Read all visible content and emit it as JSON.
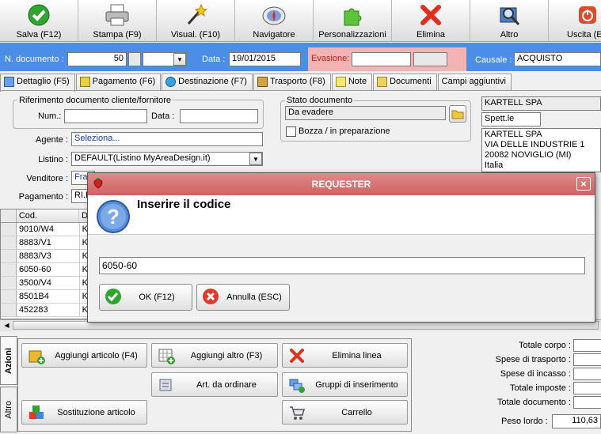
{
  "toolbar": {
    "buttons": [
      {
        "label": "Salva (F12)"
      },
      {
        "label": "Stampa (F9)"
      },
      {
        "label": "Visual. (F10)"
      },
      {
        "label": "Navigatore"
      },
      {
        "label": "Personalizzazioni"
      },
      {
        "label": "Elimina"
      },
      {
        "label": "Altro"
      },
      {
        "label": "Uscita (ES"
      }
    ]
  },
  "docbar": {
    "num_label": "N. documento :",
    "num_value": "50",
    "date_label": "Data :",
    "date_value": "19/01/2015",
    "evasione_label": "Evasione:",
    "causale_label": "Causale :",
    "causale_value": "ACQUISTO"
  },
  "tabs": [
    {
      "label": "Dettaglio (F5)"
    },
    {
      "label": "Pagamento (F6)"
    },
    {
      "label": "Destinazione (F7)"
    },
    {
      "label": "Trasporto (F8)"
    },
    {
      "label": "Note"
    },
    {
      "label": "Documenti"
    },
    {
      "label": "Campi aggiuntivi"
    }
  ],
  "form": {
    "rif_title": "Riferimento documento cliente/fornitore",
    "num_label": "Num.:",
    "data_label": "Data :",
    "agente_label": "Agente :",
    "agente_value": "Seleziona...",
    "listino_label": "Listino :",
    "listino_value": "DEFAULT(Listino MyAreaDesign.it)",
    "venditore_label": "Venditore :",
    "venditore_value": "Fran",
    "pagamento_label": "Pagamento :",
    "pagamento_value": "RI.B",
    "stato_title": "Stato documento",
    "stato_value": "Da evadere",
    "bozza_label": "Bozza / in preparazione"
  },
  "customer": {
    "name": "KARTELL SPA",
    "salutation": "Spett.le",
    "address": [
      "KARTELL SPA",
      "VIA DELLE INDUSTRIE 1",
      "20082 NOVIGLIO (MI)",
      "Italia"
    ]
  },
  "grid": {
    "headers": [
      "Cod.",
      "D"
    ],
    "rows": [
      {
        "cod": "9010/W4",
        "d": "K"
      },
      {
        "cod": "8883/V1",
        "d": "K"
      },
      {
        "cod": "8883/V3",
        "d": "K"
      },
      {
        "cod": "6050-60",
        "d": "K"
      },
      {
        "cod": "3500/V4",
        "d": "K"
      },
      {
        "cod": "8501B4",
        "d": "K"
      },
      {
        "cod": "452283",
        "d": "K"
      }
    ]
  },
  "dialog": {
    "title": "REQUESTER",
    "prompt": "Inserire il codice",
    "input_value": "6050-60",
    "ok_label": "OK (F12)",
    "cancel_label": "Annulla (ESC)",
    "close_glyph": "×"
  },
  "side_tabs": {
    "azioni": "Azioni",
    "altro": "Altro"
  },
  "actions": {
    "aggiungi_articolo": "Aggiungi articolo (F4)",
    "aggiungi_altro": "Aggiungi altro (F3)",
    "elimina_linea": "Elimina linea",
    "art_da_ordinare": "Art. da ordinare",
    "gruppi_inserimento": "Gruppi di inserimento",
    "sostituzione_articolo": "Sostituzione articolo",
    "carrello": "Carrello"
  },
  "totals": {
    "totale_corpo": "Totale corpo :",
    "spese_trasporto": "Spese di trasporto :",
    "spese_incasso": "Spese di incasso :",
    "totale_imposte": "Totale imposte :",
    "totale_documento": "Totale documento :",
    "peso_lordo_label": "Peso lordo :",
    "peso_lordo_value": "110,63"
  },
  "colors": {
    "docbar_bg": "#4a8ee8",
    "evasione_bg": "#f3b3b3",
    "dialog_title_bg": "#cf6262"
  }
}
